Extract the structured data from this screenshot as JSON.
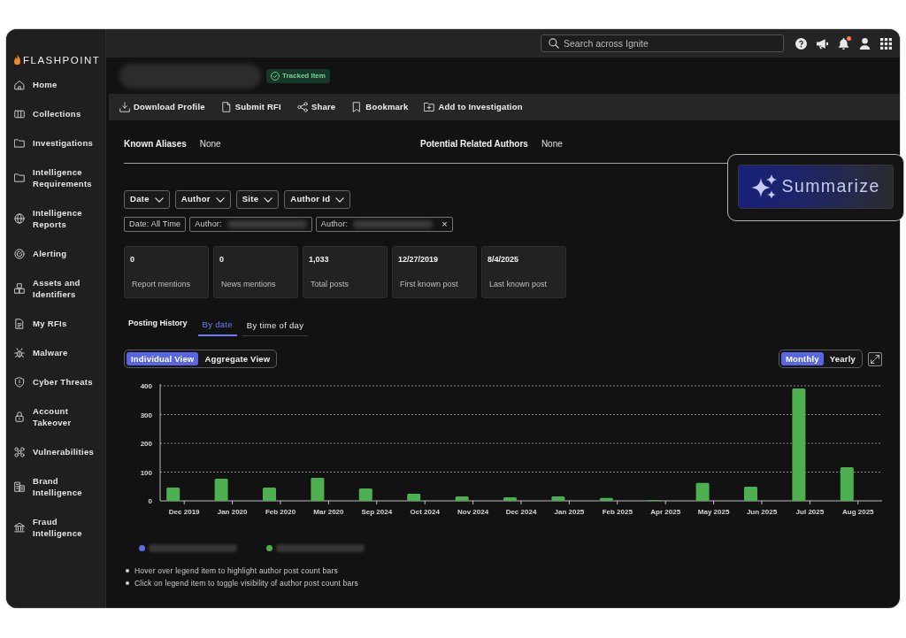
{
  "sidebar": {
    "logo": "FLASHPOINT",
    "items": [
      {
        "label": "Home"
      },
      {
        "label": "Collections"
      },
      {
        "label": "Investigations"
      },
      {
        "label": "Intelligence Requirements"
      },
      {
        "label": "Intelligence Reports"
      },
      {
        "label": "Alerting"
      },
      {
        "label": "Assets and Identifiers"
      },
      {
        "label": "My RFIs"
      },
      {
        "label": "Malware"
      },
      {
        "label": "Cyber Threats"
      },
      {
        "label": "Account Takeover"
      },
      {
        "label": "Vulnerabilities"
      },
      {
        "label": "Brand Intelligence"
      },
      {
        "label": "Fraud Intelligence"
      }
    ]
  },
  "top_bar": {
    "search": {
      "placeholder": "Search across Ignite"
    },
    "notification": true
  },
  "profile": {
    "badge": "Tracked Item"
  },
  "toolbar": [
    {
      "label": "Download Profile"
    },
    {
      "label": "Submit RFI"
    },
    {
      "label": "Share"
    },
    {
      "label": "Bookmark"
    },
    {
      "label": "Add to Investigation"
    }
  ],
  "details": [
    {
      "label": "Known Aliases",
      "value": "None"
    },
    {
      "label": "Potential Related Authors",
      "value": "None"
    }
  ],
  "filters": [
    {
      "label": "Date"
    },
    {
      "label": "Author"
    },
    {
      "label": "Site"
    },
    {
      "label": "Author Id"
    }
  ],
  "chips": [
    {
      "label": "Date: All Time",
      "redacted": false
    },
    {
      "label": "Author:",
      "redacted": true
    },
    {
      "label": "Author:",
      "redacted": true,
      "close": "×"
    }
  ],
  "stats": [
    {
      "value": "0",
      "label": "Report mentions"
    },
    {
      "value": "0",
      "label": "News mentions"
    },
    {
      "value": "1,033",
      "label": "Total posts"
    },
    {
      "value": "12/27/2019",
      "label": "First known post"
    },
    {
      "value": "8/4/2025",
      "label": "Last known post"
    }
  ],
  "posting_history": {
    "title": "Posting History",
    "tabs": [
      {
        "label": "By date",
        "selected": true
      },
      {
        "label": "By time of day",
        "selected": false
      }
    ],
    "view_toggle": [
      {
        "label": "Individual View",
        "selected": true
      },
      {
        "label": "Aggregate View",
        "selected": false
      }
    ],
    "period_toggle": [
      {
        "label": "Monthly",
        "selected": true
      },
      {
        "label": "Yearly",
        "selected": false
      }
    ],
    "chart_data": {
      "type": "bar",
      "categories": [
        "Dec 2019",
        "Jan 2020",
        "Feb 2020",
        "Mar 2020",
        "Sep 2024",
        "Oct 2024",
        "Nov 2024",
        "Dec 2024",
        "Jan 2025",
        "Feb 2025",
        "Apr 2025",
        "May 2025",
        "Jun 2025",
        "Jul 2025",
        "Aug 2025"
      ],
      "series": [
        {
          "color": "#4caf50",
          "values": [
            46,
            77,
            46,
            80,
            43,
            25,
            15,
            12,
            15,
            10,
            1,
            62,
            49,
            391,
            117
          ]
        }
      ],
      "ylim": [
        0,
        400
      ],
      "yticks": [
        0,
        100,
        200,
        300,
        400
      ],
      "grid": true
    },
    "legend": [
      {
        "color": "#5c6be6"
      },
      {
        "color": "#4caf50"
      }
    ],
    "notes": [
      "Hover over legend item to highlight author post count bars",
      "Click on legend item to toggle visibility of author post count bars"
    ]
  },
  "summarize": {
    "label": "Summarize"
  }
}
